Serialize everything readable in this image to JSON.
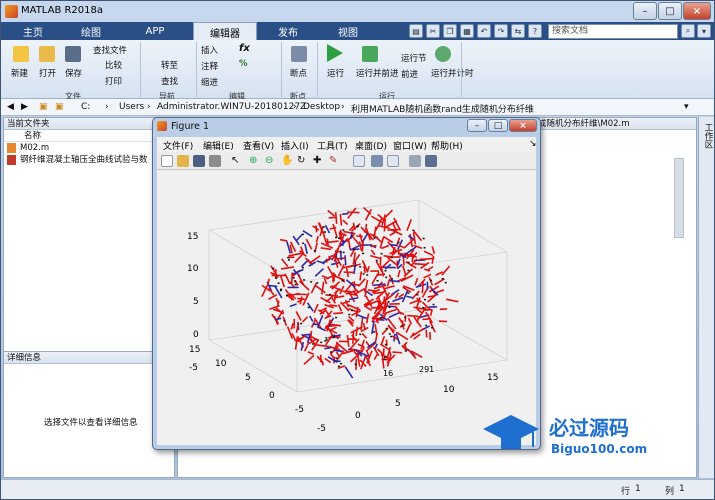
{
  "window": {
    "title": "MATLAB R2018a"
  },
  "tabs": [
    "主页",
    "绘图",
    "APP",
    "编辑器",
    "发布",
    "视图"
  ],
  "active_tab": "编辑器",
  "search": {
    "placeholder": "搜索文档"
  },
  "ribbon": {
    "file": {
      "new": "新建",
      "open": "打开",
      "save": "保存",
      "find_files": "查找文件",
      "compare": "比较",
      "print": "打印",
      "label": "文件"
    },
    "nav": {
      "goto": "转至",
      "find": "查找",
      "label": "导航"
    },
    "edit": {
      "insert": "插入",
      "comment": "注释",
      "indent": "缩进",
      "label": "编辑"
    },
    "breakpoints": {
      "button": "断点",
      "label": "断点"
    },
    "run": {
      "run": "运行",
      "run_advance": "运行并前进",
      "run_section": "运行节",
      "advance": "前进",
      "run_time": "运行并计时",
      "label": "运行"
    }
  },
  "address": {
    "parts": [
      "C:",
      "Users",
      "Administrator.WIN7U-20180127Z",
      "Desktop",
      "利用MATLAB随机函数rand生成随机分布纤维"
    ]
  },
  "left_panel": {
    "title": "当前文件夹",
    "column": "名称",
    "files": [
      "M02.m",
      "钢纤维混凝土轴压全曲线试验与数"
    ]
  },
  "detail_panel": {
    "title": "详细信息",
    "hint": "选择文件以查看详细信息"
  },
  "editor": {
    "tab_title": "成随机分布纤维\\M02.m"
  },
  "right_strip": {
    "label": "工作区"
  },
  "figure": {
    "title": "Figure 1",
    "menu": [
      "文件(F)",
      "编辑(E)",
      "查看(V)",
      "插入(I)",
      "工具(T)",
      "桌面(D)",
      "窗口(W)",
      "帮助(H)"
    ]
  },
  "plot_labels": {
    "z_ticks": [
      "15",
      "10",
      "5",
      "0",
      "-5"
    ],
    "x_ticks": [
      "-5",
      "0",
      "5",
      "10",
      "15"
    ],
    "y_ticks": [
      "15",
      "10",
      "5",
      "0",
      "-5"
    ],
    "annotations": [
      "291",
      "16"
    ]
  },
  "statusbar": {
    "row_label": "行",
    "row": "1",
    "col_label": "列",
    "col": "1"
  },
  "watermark": {
    "cn": "必过源码",
    "en": "Biguo100.com"
  }
}
